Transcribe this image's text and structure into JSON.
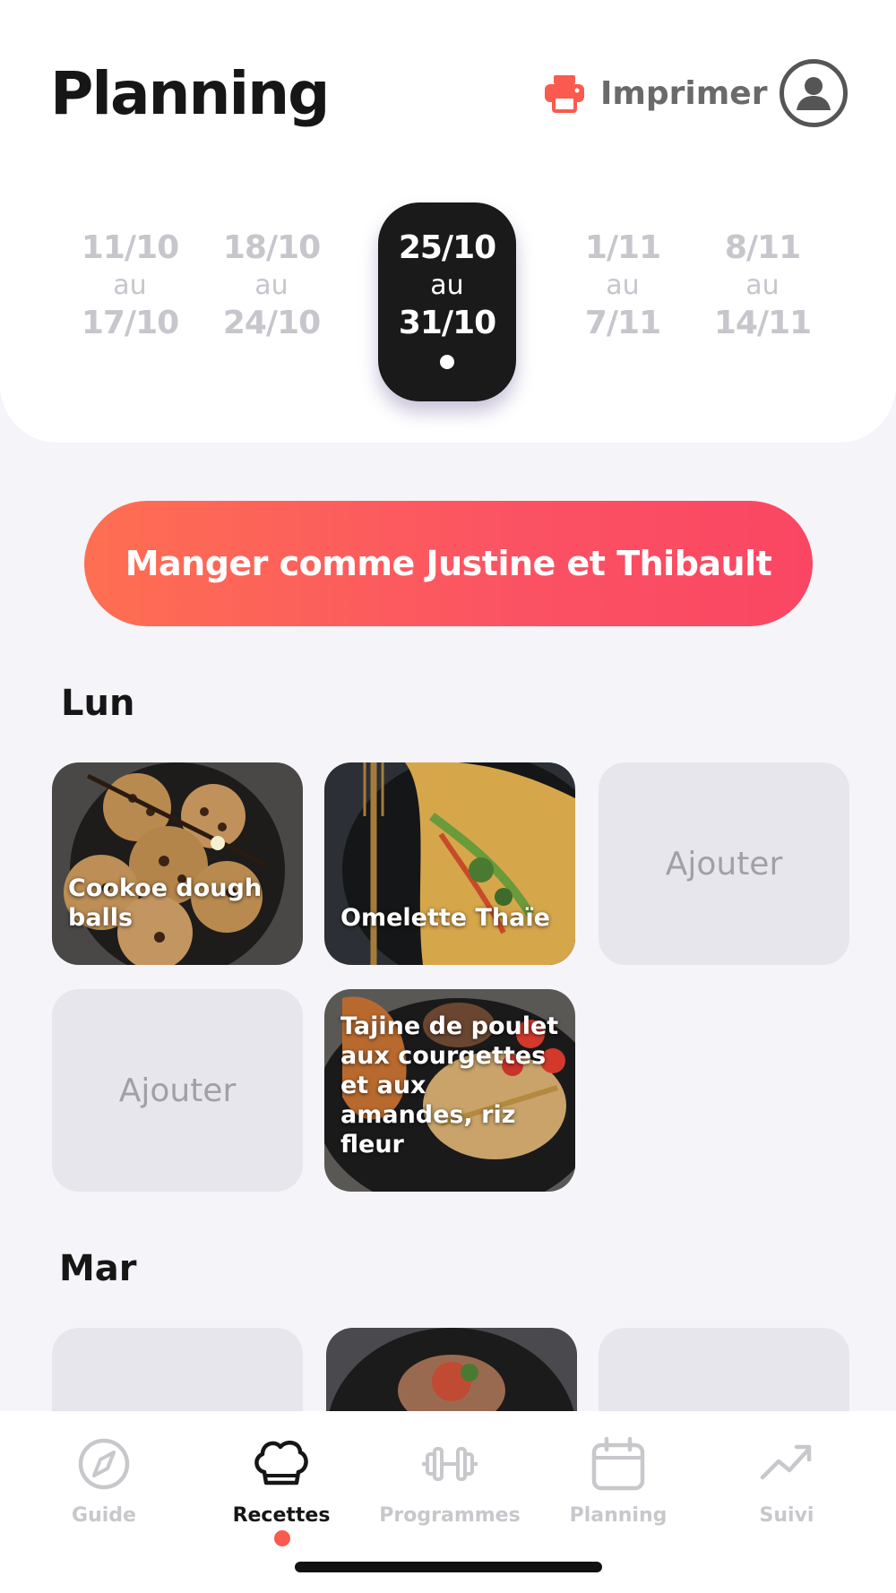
{
  "header": {
    "title": "Planning",
    "print_label": "Imprimer"
  },
  "weeks": [
    {
      "start": "11/10",
      "sep": "au",
      "end": "17/10",
      "active": false
    },
    {
      "start": "18/10",
      "sep": "au",
      "end": "24/10",
      "active": false
    },
    {
      "start": "25/10",
      "sep": "au",
      "end": "31/10",
      "active": true
    },
    {
      "start": "1/11",
      "sep": "au",
      "end": "7/11",
      "active": false
    },
    {
      "start": "8/11",
      "sep": "au",
      "end": "14/11",
      "active": false
    }
  ],
  "cta_label": "Manger comme Justine et Thibault",
  "days": [
    {
      "label": "Lun",
      "meals": [
        {
          "type": "recipe",
          "title": "Cookoe dough balls"
        },
        {
          "type": "recipe",
          "title": "Omelette Thaïe"
        },
        {
          "type": "empty",
          "title": "Ajouter"
        },
        {
          "type": "empty",
          "title": "Ajouter"
        },
        {
          "type": "recipe",
          "title": "Tajine de poulet aux courgettes et aux amandes, riz fleur"
        }
      ]
    },
    {
      "label": "Mar",
      "meals": []
    }
  ],
  "tabbar": {
    "items": [
      {
        "label": "Guide",
        "icon": "compass-icon",
        "active": false
      },
      {
        "label": "Recettes",
        "icon": "chef-hat-icon",
        "active": true
      },
      {
        "label": "Programmes",
        "icon": "dumbbell-icon",
        "active": false
      },
      {
        "label": "Planning",
        "icon": "calendar-icon",
        "active": false
      },
      {
        "label": "Suivi",
        "icon": "trend-icon",
        "active": false
      }
    ]
  },
  "colors": {
    "accent": "#fb5a4e",
    "gradient_start": "#fe6f52",
    "gradient_end": "#fa4663",
    "active_week_bg": "#1a1a1a"
  }
}
